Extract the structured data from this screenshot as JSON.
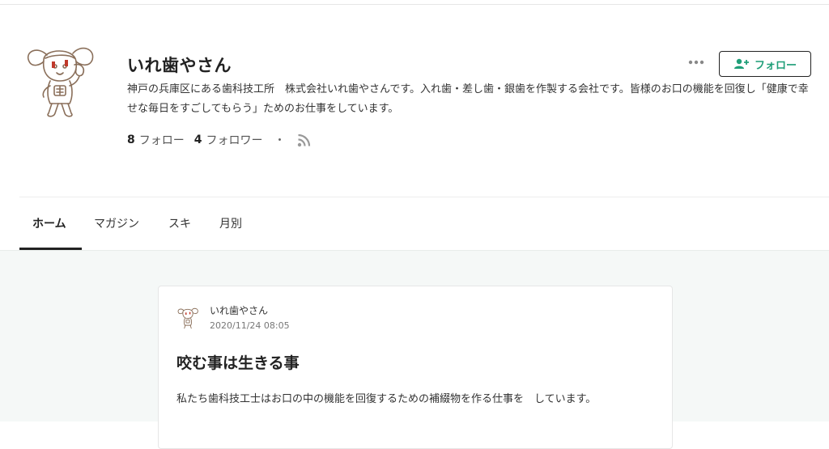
{
  "profile": {
    "name": "いれ歯やさん",
    "description": "神戸の兵庫区にある歯科技工所　株式会社いれ歯やさんです。入れ歯・差し歯・銀歯を作製する会社です。皆様のお口の機能を回復し「健康で幸せな毎日をすごしてもらう」ためのお仕事をしています。",
    "following_count": "8",
    "following_label": "フォロー",
    "followers_count": "4",
    "followers_label": "フォロワー",
    "separator": "・",
    "follow_button_label": "フォロー",
    "accent_color": "#1f9e78"
  },
  "tabs": [
    {
      "label": "ホーム",
      "active": true
    },
    {
      "label": "マガジン",
      "active": false
    },
    {
      "label": "スキ",
      "active": false
    },
    {
      "label": "月別",
      "active": false
    }
  ],
  "post": {
    "author": "いれ歯やさん",
    "date": "2020/11/24 08:05",
    "title": "咬む事は生きる事",
    "excerpt": "私たち歯科技工士はお口の中の機能を回復するための補綴物を作る仕事を　しています。"
  },
  "icons": {
    "more": "more-dots-icon",
    "follow": "user-plus-icon",
    "rss": "rss-icon",
    "avatar": "mascot-avatar"
  }
}
